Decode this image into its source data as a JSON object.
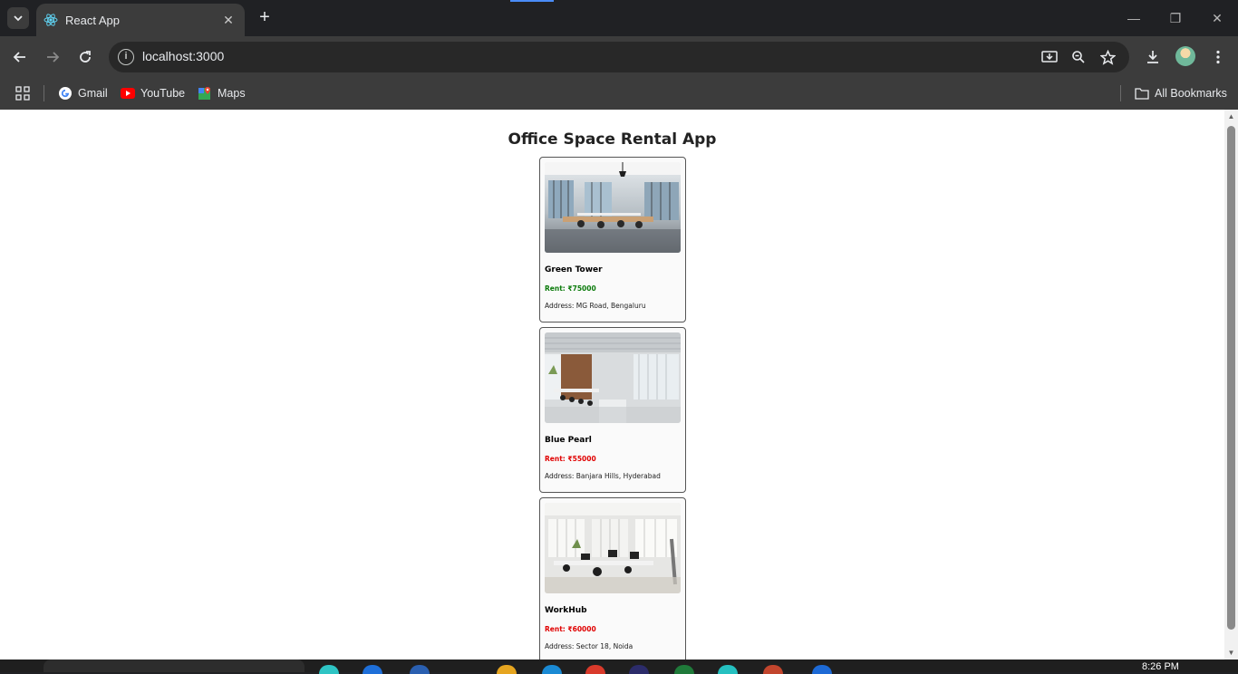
{
  "browser": {
    "tab_title": "React App",
    "url": "localhost:3000",
    "bookmarks": [
      {
        "label": "Gmail",
        "icon": "gmail-icon"
      },
      {
        "label": "YouTube",
        "icon": "youtube-icon"
      },
      {
        "label": "Maps",
        "icon": "maps-icon"
      }
    ],
    "all_bookmarks_label": "All Bookmarks"
  },
  "page": {
    "heading": "Office Space Rental App",
    "offices": [
      {
        "name": "Green Tower",
        "rent": "Rent: ₹75000",
        "rent_color": "#0a7a0a",
        "address": "Address: MG Road, Bengaluru"
      },
      {
        "name": "Blue Pearl",
        "rent": "Rent: ₹55000",
        "rent_color": "#e00000",
        "address": "Address: Banjara Hills, Hyderabad"
      },
      {
        "name": "WorkHub",
        "rent": "Rent: ₹60000",
        "rent_color": "#e00000",
        "address": "Address: Sector 18, Noida"
      }
    ]
  },
  "taskbar": {
    "time": "8:26 PM"
  }
}
